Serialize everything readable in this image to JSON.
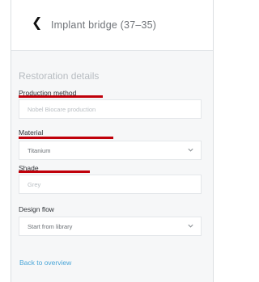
{
  "header": {
    "title": "Implant bridge (37–35)"
  },
  "section": {
    "title": "Restoration details"
  },
  "fields": {
    "production_method": {
      "label": "Production method",
      "placeholder": "Nobel Biocare production"
    },
    "material": {
      "label": "Material",
      "value": "Titanium"
    },
    "shade": {
      "label": "Shade",
      "placeholder": "Grey"
    },
    "design_flow": {
      "label": "Design flow",
      "value": "Start from library"
    }
  },
  "footer": {
    "back_link": "Back to overview"
  },
  "colors": {
    "annotation_underline": "#c0000a",
    "link": "#4aa6d8"
  },
  "icons": {
    "back": "chevron-left-icon",
    "dropdown": "chevron-down-icon"
  }
}
